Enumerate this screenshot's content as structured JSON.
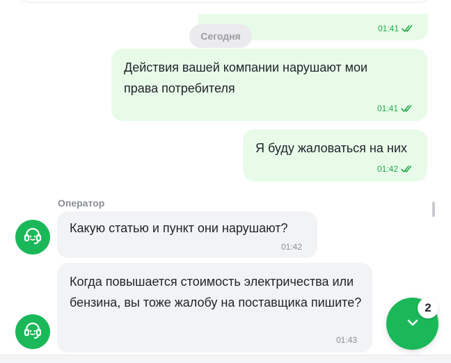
{
  "chat": {
    "date_divider": "Сегодня",
    "messages_out": [
      {
        "text": "",
        "time": "01:41",
        "status_icon": "double-check-icon"
      },
      {
        "text": "Действия вашей компании нарушают мои права потребителя",
        "time": "01:41",
        "status_icon": "double-check-icon"
      },
      {
        "text": "Я буду жаловаться на них",
        "time": "01:42",
        "status_icon": "double-check-icon"
      }
    ],
    "operator_label": "Оператор",
    "messages_in": [
      {
        "text": "Какую статью и пункт они нарушают?",
        "time": "01:42"
      },
      {
        "text": "Когда повышается стоимость электричества или бензина, вы тоже жалобу на поставщика пишите?",
        "time": "01:43"
      }
    ]
  },
  "scroll_button": {
    "badge_count": "2",
    "icon": "chevron-down-icon"
  },
  "colors": {
    "accent": "#1bb85a",
    "outgoing_bubble": "#e8fbe9",
    "incoming_bubble": "#f2f3f5",
    "time_outgoing": "#22a84a"
  }
}
